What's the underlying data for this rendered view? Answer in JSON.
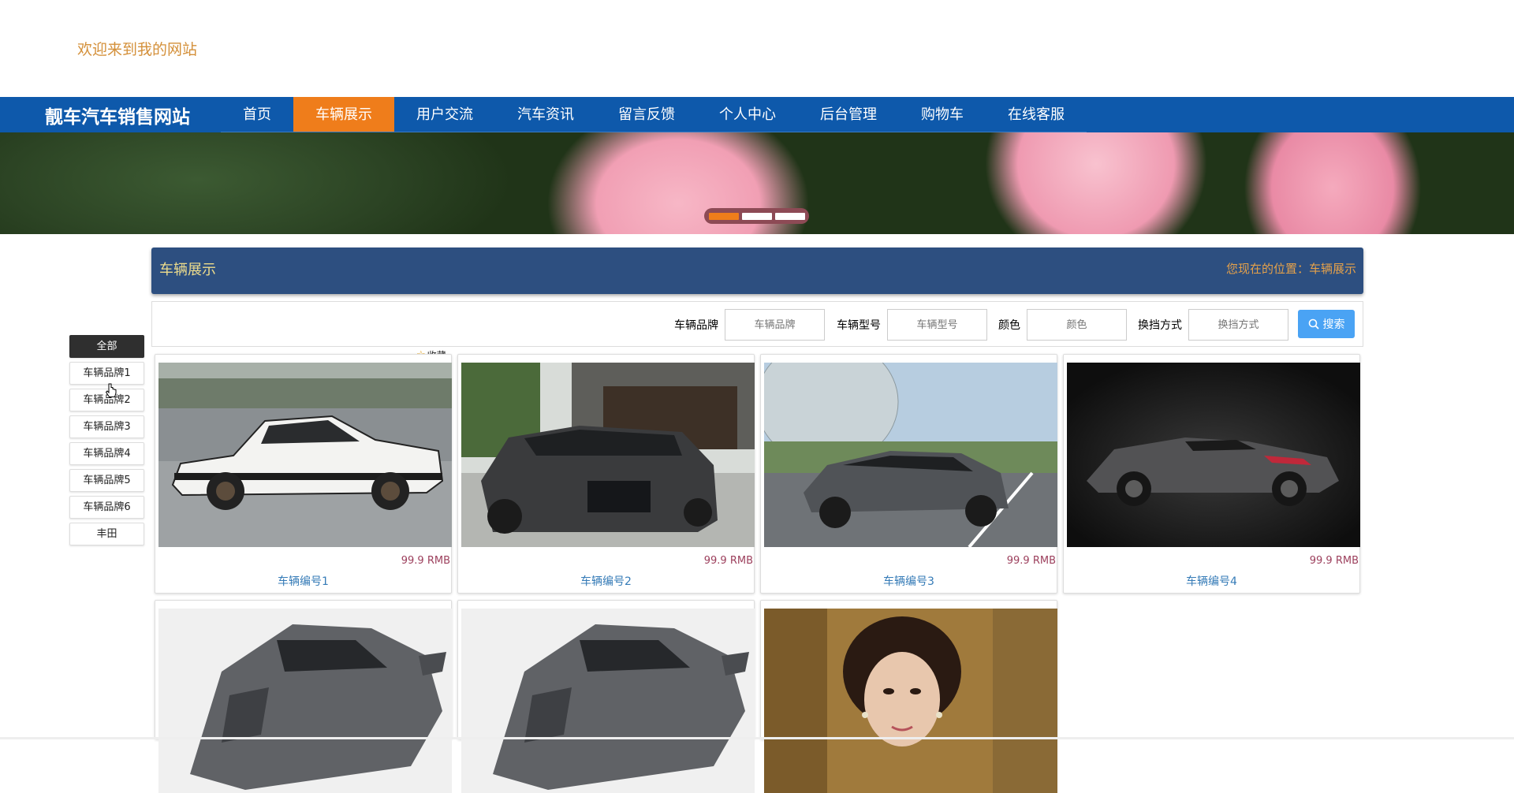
{
  "welcome": {
    "text": "欢迎来到我的网站"
  },
  "nav": {
    "brand": "靓车汽车销售网站",
    "items": [
      {
        "label": "首页",
        "active": false
      },
      {
        "label": "车辆展示",
        "active": true
      },
      {
        "label": "用户交流",
        "active": false
      },
      {
        "label": "汽车资讯",
        "active": false
      },
      {
        "label": "留言反馈",
        "active": false
      },
      {
        "label": "个人中心",
        "active": false
      },
      {
        "label": "后台管理",
        "active": false
      },
      {
        "label": "购物车",
        "active": false
      },
      {
        "label": "在线客服",
        "active": false
      }
    ]
  },
  "banner": {
    "slides": 3,
    "active_slide": 1
  },
  "section": {
    "title": "车辆展示",
    "location": "您现在的位置：车辆展示"
  },
  "search": {
    "fields": [
      {
        "label": "车辆品牌",
        "placeholder": "车辆品牌"
      },
      {
        "label": "车辆型号",
        "placeholder": "车辆型号"
      },
      {
        "label": "颜色",
        "placeholder": "颜色"
      },
      {
        "label": "换挡方式",
        "placeholder": "换挡方式"
      }
    ],
    "button_label": "搜索"
  },
  "categories": [
    {
      "label": "全部",
      "active": true
    },
    {
      "label": "车辆品牌1",
      "active": false
    },
    {
      "label": "车辆品牌2",
      "active": false
    },
    {
      "label": "车辆品牌3",
      "active": false
    },
    {
      "label": "车辆品牌4",
      "active": false
    },
    {
      "label": "车辆品牌5",
      "active": false
    },
    {
      "label": "车辆品牌6",
      "active": false
    },
    {
      "label": "丰田",
      "active": false
    }
  ],
  "favorite_label": "收藏",
  "products": [
    {
      "name": "车辆编号1",
      "price": "99.9 RMB",
      "image": "white-black-hatchback-car"
    },
    {
      "name": "车辆编号2",
      "price": "99.9 RMB",
      "image": "dark-gray-honda-accord-front"
    },
    {
      "name": "车辆编号3",
      "price": "99.9 RMB",
      "image": "gray-sedan-on-road"
    },
    {
      "name": "车辆编号4",
      "price": "99.9 RMB",
      "image": "dark-concept-coupe"
    },
    {
      "name": "",
      "price": "",
      "image": "gray-supercar"
    },
    {
      "name": "",
      "price": "",
      "image": "gray-supercar"
    },
    {
      "name": "",
      "price": "",
      "image": "woman-portrait"
    }
  ],
  "colors": {
    "nav_bg": "#0e59ab",
    "accent": "#ef7d1b",
    "section_bg": "#2d4f80",
    "search_button": "#4aa3f4"
  },
  "icons": {
    "search": "search-icon",
    "favorite": "star-icon"
  }
}
